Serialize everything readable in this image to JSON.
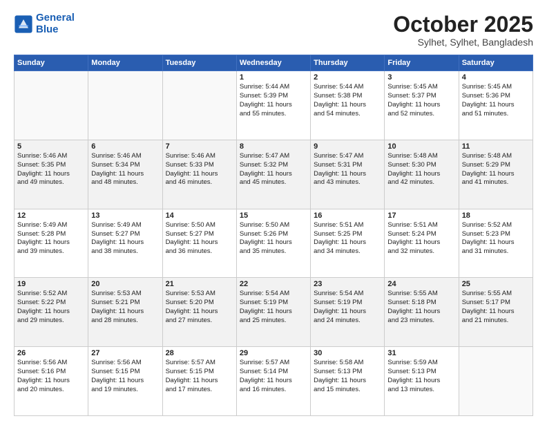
{
  "header": {
    "logo_line1": "General",
    "logo_line2": "Blue",
    "month": "October 2025",
    "location": "Sylhet, Sylhet, Bangladesh"
  },
  "weekdays": [
    "Sunday",
    "Monday",
    "Tuesday",
    "Wednesday",
    "Thursday",
    "Friday",
    "Saturday"
  ],
  "rows": [
    [
      {
        "num": "",
        "sunrise": "",
        "sunset": "",
        "daylight": "",
        "empty": true
      },
      {
        "num": "",
        "sunrise": "",
        "sunset": "",
        "daylight": "",
        "empty": true
      },
      {
        "num": "",
        "sunrise": "",
        "sunset": "",
        "daylight": "",
        "empty": true
      },
      {
        "num": "1",
        "sunrise": "Sunrise: 5:44 AM",
        "sunset": "Sunset: 5:39 PM",
        "daylight": "Daylight: 11 hours",
        "daylight2": "and 55 minutes."
      },
      {
        "num": "2",
        "sunrise": "Sunrise: 5:44 AM",
        "sunset": "Sunset: 5:38 PM",
        "daylight": "Daylight: 11 hours",
        "daylight2": "and 54 minutes."
      },
      {
        "num": "3",
        "sunrise": "Sunrise: 5:45 AM",
        "sunset": "Sunset: 5:37 PM",
        "daylight": "Daylight: 11 hours",
        "daylight2": "and 52 minutes."
      },
      {
        "num": "4",
        "sunrise": "Sunrise: 5:45 AM",
        "sunset": "Sunset: 5:36 PM",
        "daylight": "Daylight: 11 hours",
        "daylight2": "and 51 minutes."
      }
    ],
    [
      {
        "num": "5",
        "sunrise": "Sunrise: 5:46 AM",
        "sunset": "Sunset: 5:35 PM",
        "daylight": "Daylight: 11 hours",
        "daylight2": "and 49 minutes."
      },
      {
        "num": "6",
        "sunrise": "Sunrise: 5:46 AM",
        "sunset": "Sunset: 5:34 PM",
        "daylight": "Daylight: 11 hours",
        "daylight2": "and 48 minutes."
      },
      {
        "num": "7",
        "sunrise": "Sunrise: 5:46 AM",
        "sunset": "Sunset: 5:33 PM",
        "daylight": "Daylight: 11 hours",
        "daylight2": "and 46 minutes."
      },
      {
        "num": "8",
        "sunrise": "Sunrise: 5:47 AM",
        "sunset": "Sunset: 5:32 PM",
        "daylight": "Daylight: 11 hours",
        "daylight2": "and 45 minutes."
      },
      {
        "num": "9",
        "sunrise": "Sunrise: 5:47 AM",
        "sunset": "Sunset: 5:31 PM",
        "daylight": "Daylight: 11 hours",
        "daylight2": "and 43 minutes."
      },
      {
        "num": "10",
        "sunrise": "Sunrise: 5:48 AM",
        "sunset": "Sunset: 5:30 PM",
        "daylight": "Daylight: 11 hours",
        "daylight2": "and 42 minutes."
      },
      {
        "num": "11",
        "sunrise": "Sunrise: 5:48 AM",
        "sunset": "Sunset: 5:29 PM",
        "daylight": "Daylight: 11 hours",
        "daylight2": "and 41 minutes."
      }
    ],
    [
      {
        "num": "12",
        "sunrise": "Sunrise: 5:49 AM",
        "sunset": "Sunset: 5:28 PM",
        "daylight": "Daylight: 11 hours",
        "daylight2": "and 39 minutes."
      },
      {
        "num": "13",
        "sunrise": "Sunrise: 5:49 AM",
        "sunset": "Sunset: 5:27 PM",
        "daylight": "Daylight: 11 hours",
        "daylight2": "and 38 minutes."
      },
      {
        "num": "14",
        "sunrise": "Sunrise: 5:50 AM",
        "sunset": "Sunset: 5:27 PM",
        "daylight": "Daylight: 11 hours",
        "daylight2": "and 36 minutes."
      },
      {
        "num": "15",
        "sunrise": "Sunrise: 5:50 AM",
        "sunset": "Sunset: 5:26 PM",
        "daylight": "Daylight: 11 hours",
        "daylight2": "and 35 minutes."
      },
      {
        "num": "16",
        "sunrise": "Sunrise: 5:51 AM",
        "sunset": "Sunset: 5:25 PM",
        "daylight": "Daylight: 11 hours",
        "daylight2": "and 34 minutes."
      },
      {
        "num": "17",
        "sunrise": "Sunrise: 5:51 AM",
        "sunset": "Sunset: 5:24 PM",
        "daylight": "Daylight: 11 hours",
        "daylight2": "and 32 minutes."
      },
      {
        "num": "18",
        "sunrise": "Sunrise: 5:52 AM",
        "sunset": "Sunset: 5:23 PM",
        "daylight": "Daylight: 11 hours",
        "daylight2": "and 31 minutes."
      }
    ],
    [
      {
        "num": "19",
        "sunrise": "Sunrise: 5:52 AM",
        "sunset": "Sunset: 5:22 PM",
        "daylight": "Daylight: 11 hours",
        "daylight2": "and 29 minutes."
      },
      {
        "num": "20",
        "sunrise": "Sunrise: 5:53 AM",
        "sunset": "Sunset: 5:21 PM",
        "daylight": "Daylight: 11 hours",
        "daylight2": "and 28 minutes."
      },
      {
        "num": "21",
        "sunrise": "Sunrise: 5:53 AM",
        "sunset": "Sunset: 5:20 PM",
        "daylight": "Daylight: 11 hours",
        "daylight2": "and 27 minutes."
      },
      {
        "num": "22",
        "sunrise": "Sunrise: 5:54 AM",
        "sunset": "Sunset: 5:19 PM",
        "daylight": "Daylight: 11 hours",
        "daylight2": "and 25 minutes."
      },
      {
        "num": "23",
        "sunrise": "Sunrise: 5:54 AM",
        "sunset": "Sunset: 5:19 PM",
        "daylight": "Daylight: 11 hours",
        "daylight2": "and 24 minutes."
      },
      {
        "num": "24",
        "sunrise": "Sunrise: 5:55 AM",
        "sunset": "Sunset: 5:18 PM",
        "daylight": "Daylight: 11 hours",
        "daylight2": "and 23 minutes."
      },
      {
        "num": "25",
        "sunrise": "Sunrise: 5:55 AM",
        "sunset": "Sunset: 5:17 PM",
        "daylight": "Daylight: 11 hours",
        "daylight2": "and 21 minutes."
      }
    ],
    [
      {
        "num": "26",
        "sunrise": "Sunrise: 5:56 AM",
        "sunset": "Sunset: 5:16 PM",
        "daylight": "Daylight: 11 hours",
        "daylight2": "and 20 minutes."
      },
      {
        "num": "27",
        "sunrise": "Sunrise: 5:56 AM",
        "sunset": "Sunset: 5:15 PM",
        "daylight": "Daylight: 11 hours",
        "daylight2": "and 19 minutes."
      },
      {
        "num": "28",
        "sunrise": "Sunrise: 5:57 AM",
        "sunset": "Sunset: 5:15 PM",
        "daylight": "Daylight: 11 hours",
        "daylight2": "and 17 minutes."
      },
      {
        "num": "29",
        "sunrise": "Sunrise: 5:57 AM",
        "sunset": "Sunset: 5:14 PM",
        "daylight": "Daylight: 11 hours",
        "daylight2": "and 16 minutes."
      },
      {
        "num": "30",
        "sunrise": "Sunrise: 5:58 AM",
        "sunset": "Sunset: 5:13 PM",
        "daylight": "Daylight: 11 hours",
        "daylight2": "and 15 minutes."
      },
      {
        "num": "31",
        "sunrise": "Sunrise: 5:59 AM",
        "sunset": "Sunset: 5:13 PM",
        "daylight": "Daylight: 11 hours",
        "daylight2": "and 13 minutes."
      },
      {
        "num": "",
        "sunrise": "",
        "sunset": "",
        "daylight": "",
        "daylight2": "",
        "empty": true
      }
    ]
  ]
}
